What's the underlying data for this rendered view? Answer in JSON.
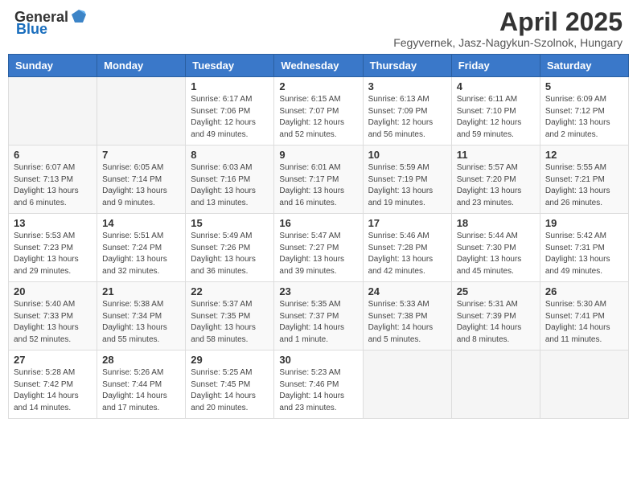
{
  "header": {
    "logo_general": "General",
    "logo_blue": "Blue",
    "month_title": "April 2025",
    "subtitle": "Fegyvernek, Jasz-Nagykun-Szolnok, Hungary"
  },
  "days_of_week": [
    "Sunday",
    "Monday",
    "Tuesday",
    "Wednesday",
    "Thursday",
    "Friday",
    "Saturday"
  ],
  "weeks": [
    [
      {
        "day": "",
        "info": ""
      },
      {
        "day": "",
        "info": ""
      },
      {
        "day": "1",
        "info": "Sunrise: 6:17 AM\nSunset: 7:06 PM\nDaylight: 12 hours and 49 minutes."
      },
      {
        "day": "2",
        "info": "Sunrise: 6:15 AM\nSunset: 7:07 PM\nDaylight: 12 hours and 52 minutes."
      },
      {
        "day": "3",
        "info": "Sunrise: 6:13 AM\nSunset: 7:09 PM\nDaylight: 12 hours and 56 minutes."
      },
      {
        "day": "4",
        "info": "Sunrise: 6:11 AM\nSunset: 7:10 PM\nDaylight: 12 hours and 59 minutes."
      },
      {
        "day": "5",
        "info": "Sunrise: 6:09 AM\nSunset: 7:12 PM\nDaylight: 13 hours and 2 minutes."
      }
    ],
    [
      {
        "day": "6",
        "info": "Sunrise: 6:07 AM\nSunset: 7:13 PM\nDaylight: 13 hours and 6 minutes."
      },
      {
        "day": "7",
        "info": "Sunrise: 6:05 AM\nSunset: 7:14 PM\nDaylight: 13 hours and 9 minutes."
      },
      {
        "day": "8",
        "info": "Sunrise: 6:03 AM\nSunset: 7:16 PM\nDaylight: 13 hours and 13 minutes."
      },
      {
        "day": "9",
        "info": "Sunrise: 6:01 AM\nSunset: 7:17 PM\nDaylight: 13 hours and 16 minutes."
      },
      {
        "day": "10",
        "info": "Sunrise: 5:59 AM\nSunset: 7:19 PM\nDaylight: 13 hours and 19 minutes."
      },
      {
        "day": "11",
        "info": "Sunrise: 5:57 AM\nSunset: 7:20 PM\nDaylight: 13 hours and 23 minutes."
      },
      {
        "day": "12",
        "info": "Sunrise: 5:55 AM\nSunset: 7:21 PM\nDaylight: 13 hours and 26 minutes."
      }
    ],
    [
      {
        "day": "13",
        "info": "Sunrise: 5:53 AM\nSunset: 7:23 PM\nDaylight: 13 hours and 29 minutes."
      },
      {
        "day": "14",
        "info": "Sunrise: 5:51 AM\nSunset: 7:24 PM\nDaylight: 13 hours and 32 minutes."
      },
      {
        "day": "15",
        "info": "Sunrise: 5:49 AM\nSunset: 7:26 PM\nDaylight: 13 hours and 36 minutes."
      },
      {
        "day": "16",
        "info": "Sunrise: 5:47 AM\nSunset: 7:27 PM\nDaylight: 13 hours and 39 minutes."
      },
      {
        "day": "17",
        "info": "Sunrise: 5:46 AM\nSunset: 7:28 PM\nDaylight: 13 hours and 42 minutes."
      },
      {
        "day": "18",
        "info": "Sunrise: 5:44 AM\nSunset: 7:30 PM\nDaylight: 13 hours and 45 minutes."
      },
      {
        "day": "19",
        "info": "Sunrise: 5:42 AM\nSunset: 7:31 PM\nDaylight: 13 hours and 49 minutes."
      }
    ],
    [
      {
        "day": "20",
        "info": "Sunrise: 5:40 AM\nSunset: 7:33 PM\nDaylight: 13 hours and 52 minutes."
      },
      {
        "day": "21",
        "info": "Sunrise: 5:38 AM\nSunset: 7:34 PM\nDaylight: 13 hours and 55 minutes."
      },
      {
        "day": "22",
        "info": "Sunrise: 5:37 AM\nSunset: 7:35 PM\nDaylight: 13 hours and 58 minutes."
      },
      {
        "day": "23",
        "info": "Sunrise: 5:35 AM\nSunset: 7:37 PM\nDaylight: 14 hours and 1 minute."
      },
      {
        "day": "24",
        "info": "Sunrise: 5:33 AM\nSunset: 7:38 PM\nDaylight: 14 hours and 5 minutes."
      },
      {
        "day": "25",
        "info": "Sunrise: 5:31 AM\nSunset: 7:39 PM\nDaylight: 14 hours and 8 minutes."
      },
      {
        "day": "26",
        "info": "Sunrise: 5:30 AM\nSunset: 7:41 PM\nDaylight: 14 hours and 11 minutes."
      }
    ],
    [
      {
        "day": "27",
        "info": "Sunrise: 5:28 AM\nSunset: 7:42 PM\nDaylight: 14 hours and 14 minutes."
      },
      {
        "day": "28",
        "info": "Sunrise: 5:26 AM\nSunset: 7:44 PM\nDaylight: 14 hours and 17 minutes."
      },
      {
        "day": "29",
        "info": "Sunrise: 5:25 AM\nSunset: 7:45 PM\nDaylight: 14 hours and 20 minutes."
      },
      {
        "day": "30",
        "info": "Sunrise: 5:23 AM\nSunset: 7:46 PM\nDaylight: 14 hours and 23 minutes."
      },
      {
        "day": "",
        "info": ""
      },
      {
        "day": "",
        "info": ""
      },
      {
        "day": "",
        "info": ""
      }
    ]
  ]
}
